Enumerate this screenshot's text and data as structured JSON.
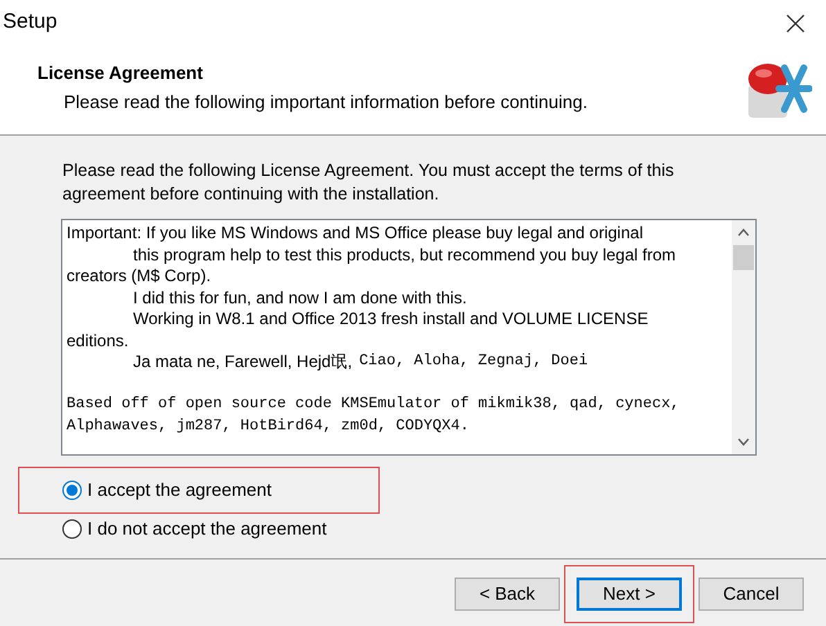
{
  "window": {
    "title": "Setup"
  },
  "header": {
    "title": "License Agreement",
    "subtitle": "Please read the following important information before continuing."
  },
  "instruction": "Please read the following License Agreement. You must accept the terms of this agreement before continuing with the installation.",
  "license_text": [
    {
      "lines": [
        {
          "indented": false,
          "segments": [
            {
              "kind": "sans",
              "text": "Important: If you like MS Windows and MS Office please buy legal and original"
            }
          ]
        },
        {
          "indented": true,
          "segments": [
            {
              "kind": "sans",
              "text": "this program help to test this products, but recommend you buy legal from"
            }
          ]
        },
        {
          "indented": false,
          "segments": [
            {
              "kind": "sans",
              "text": "creators (M$ Corp)."
            }
          ]
        },
        {
          "indented": true,
          "segments": [
            {
              "kind": "sans",
              "text": "I did this for fun, and now I am done with this."
            }
          ]
        },
        {
          "indented": true,
          "segments": [
            {
              "kind": "sans",
              "text": "Working in W8.1 and Office 2013 fresh install and VOLUME LICENSE"
            }
          ]
        },
        {
          "indented": false,
          "segments": [
            {
              "kind": "sans",
              "text": "editions."
            }
          ]
        },
        {
          "indented": true,
          "segments": [
            {
              "kind": "sans",
              "text": "Ja mata ne, Farewell, Hejd氓,"
            },
            {
              "kind": "mono",
              "text": "Ciao, Aloha, Zegnaj, Doei"
            }
          ]
        }
      ]
    },
    {
      "lines": [
        {
          "indented": false,
          "segments": [
            {
              "kind": "mono",
              "text": "Based off of open source code KMSEmulator of mikmik38, qad, cynecx,"
            }
          ]
        },
        {
          "indented": false,
          "segments": [
            {
              "kind": "mono",
              "text": "Alphawaves, jm287, HotBird64, zm0d, CODYQX4."
            }
          ]
        }
      ]
    }
  ],
  "options": [
    {
      "label": "I accept the agreement",
      "selected": true,
      "highlighted": true
    },
    {
      "label": "I do not accept the agreement",
      "selected": false,
      "highlighted": false
    }
  ],
  "buttons": [
    {
      "label": "< Back",
      "default": false,
      "highlighted": false
    },
    {
      "label": "Next >",
      "default": true,
      "highlighted": true
    },
    {
      "label": "Cancel",
      "default": false,
      "highlighted": false
    }
  ]
}
